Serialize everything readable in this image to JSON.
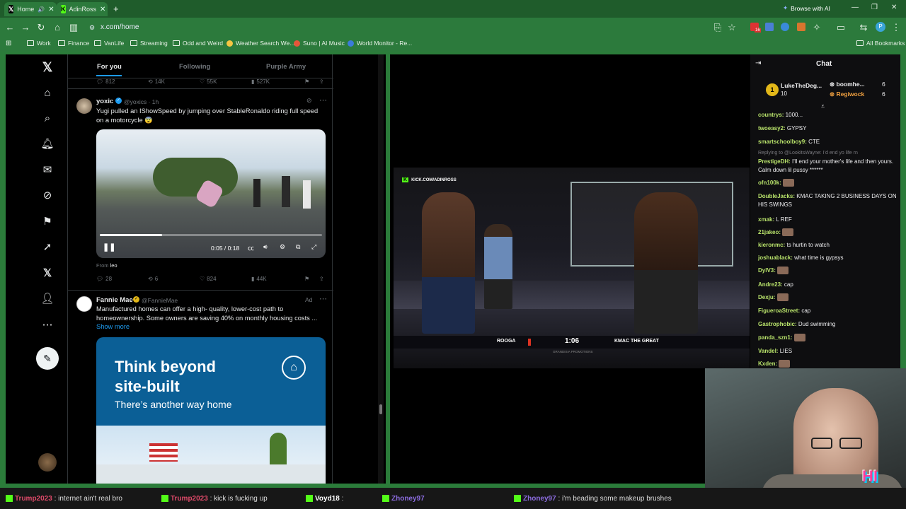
{
  "browser": {
    "tabs": [
      {
        "label": "Home"
      },
      {
        "label": "AdinRoss"
      }
    ],
    "ai_button": "Browse with AI",
    "url": "x.com/home",
    "bookmarks": [
      "Work",
      "Finance",
      "VanLife",
      "Streaming",
      "Odd and Weird",
      "Weather Search We...",
      "Suno | AI Music",
      "World Monitor - Re..."
    ],
    "all_bookmarks": "All Bookmarks",
    "extension_badge": "16"
  },
  "x": {
    "tabs": {
      "for_you": "For you",
      "following": "Following",
      "purple_army": "Purple Army"
    },
    "top_stats": {
      "replies": "812",
      "reposts": "14K",
      "likes": "55K",
      "views": "527K"
    },
    "tweet1": {
      "name": "yoxic",
      "handle": "@yoxics · 1h",
      "text": "Yugi pulled an IShowSpeed by jumping over StableRonaldo riding full speed on a motorcycle 😨",
      "video_time": "0:05 / 0:18",
      "video_progress": 0.28,
      "from_prefix": "From",
      "from_user": "leo",
      "stats": {
        "replies": "28",
        "reposts": "6",
        "likes": "824",
        "views": "44K"
      }
    },
    "tweet2": {
      "name": "Fannie Mae",
      "handle": "@FannieMae",
      "ad_label": "Ad",
      "text": "Manufactured homes can offer a high- quality, lower-cost path to homeownership. Some owners are saving 40% on monthly housing costs ...",
      "show_more": "Show more",
      "banner_title": "Think beyond site-built",
      "banner_line1": "Think beyond",
      "banner_line2": "site-built",
      "banner_sub": "There’s another way home"
    }
  },
  "stream": {
    "watermark": "KICK.COM/ADINROSS",
    "fighter_left": "ROOGA",
    "fighter_right": "KMAC THE GREAT",
    "clock": "1:06",
    "promo": "GRANDISIA PROMOTIONS"
  },
  "chat": {
    "title": "Chat",
    "leaders": [
      {
        "rank": "1",
        "name": "LukeTheDeg...",
        "count": "10"
      },
      {
        "name": "boomhe...",
        "count": "6"
      },
      {
        "name": "Regiwock",
        "count": "6"
      }
    ],
    "messages": [
      {
        "user": "countrys",
        "text": "1000...",
        "color": "#b9e36b"
      },
      {
        "user": "twoeasy2",
        "text": "GYPSY",
        "color": "#b9e36b"
      },
      {
        "user": "smartschoolboy9",
        "text": "CTE",
        "color": "#b9e36b"
      },
      {
        "user": "",
        "text": "Replying to @LookitsWayne: I'd end yo life rn",
        "color": "#7b7b80"
      },
      {
        "user": "PrestigeDH",
        "text": "I'll end your mother's life and then yours. Calm down lil pussy ******",
        "color": "#b9e36b"
      },
      {
        "user": "ofn100k",
        "text": "",
        "color": "#b9e36b"
      },
      {
        "user": "DoubleJacks",
        "text": "KMAC TAKING 2 BUSINESS DAYS ON HIS SWINGS",
        "color": "#b9e36b"
      },
      {
        "user": "xmak",
        "text": "L REF",
        "color": "#b9e36b"
      },
      {
        "user": "21jakeo",
        "text": "",
        "color": "#b9e36b"
      },
      {
        "user": "kieronmc",
        "text": "ts hurtin to watch",
        "color": "#b9e36b"
      },
      {
        "user": "joshuablack",
        "text": "what time is gypsys",
        "color": "#b9e36b"
      },
      {
        "user": "DylV3",
        "text": "",
        "color": "#b9e36b"
      },
      {
        "user": "Andre23",
        "text": "cap",
        "color": "#b9e36b"
      },
      {
        "user": "Dexju",
        "text": "",
        "color": "#b9e36b"
      },
      {
        "user": "FigueroaStreet",
        "text": "cap",
        "color": "#b9e36b"
      },
      {
        "user": "Gastrophobic",
        "text": "Dud swimming",
        "color": "#b9e36b"
      },
      {
        "user": "panda_szn1",
        "text": "",
        "color": "#b9e36b"
      },
      {
        "user": "Vandel",
        "text": "LIES",
        "color": "#b9e36b"
      },
      {
        "user": "Kxden",
        "text": "",
        "color": "#b9e36b"
      }
    ]
  },
  "ticker": [
    {
      "user": "Trump2023",
      "text": ": internet ain't real bro",
      "color": "#e04a6a"
    },
    {
      "user": "Trump2023",
      "text": ": kick is fucking up",
      "color": "#e04a6a"
    },
    {
      "user": "Voyd18",
      "text": ":",
      "color": "#ffffff"
    },
    {
      "user": "Zhoney97",
      "text": "",
      "color": "#8c6ce0"
    },
    {
      "user": "Zhoney97",
      "text": ": i'm beading some makeup brushes",
      "color": "#8c6ce0"
    }
  ],
  "webcam_logo": "HI TV",
  "colors": {
    "accent": "#1d9bf0",
    "frame": "#2b7c3a",
    "kick": "#53fc18"
  }
}
